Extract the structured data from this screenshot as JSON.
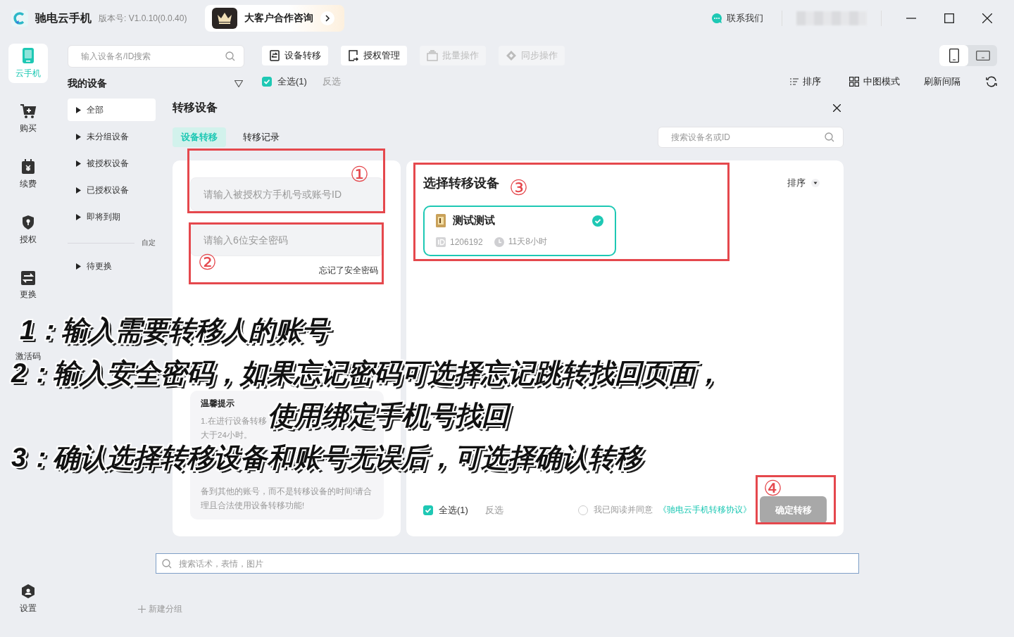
{
  "window": {
    "app_name": "驰电云手机",
    "version": "版本号: V1.0.10(0.0.40)",
    "promo": "大客户合作咨询",
    "contact": "联系我们"
  },
  "nav": [
    {
      "kind": "phone",
      "label": "云手机",
      "selected": true
    },
    {
      "kind": "cart",
      "label": "购买",
      "selected": false
    },
    {
      "kind": "renew",
      "label": "续费",
      "selected": false
    },
    {
      "kind": "shield",
      "label": "授权",
      "selected": false
    },
    {
      "kind": "swap",
      "label": "更换",
      "selected": false
    },
    {
      "kind": "code",
      "label": "激活码",
      "selected": false
    }
  ],
  "settings": "设置",
  "groups": {
    "search_placeholder": "输入设备名/ID搜索",
    "title": "我的设备",
    "items": [
      {
        "label": "全部",
        "selected": true
      },
      {
        "label": "未分组设备",
        "selected": false
      },
      {
        "label": "被授权设备",
        "selected": false
      },
      {
        "label": "已授权设备",
        "selected": false
      },
      {
        "label": "即将到期",
        "selected": false
      }
    ],
    "custom_label": "自定",
    "extra_items": [
      {
        "label": "待更换",
        "selected": false
      }
    ],
    "new_group": "新建分组"
  },
  "toolbar": {
    "buttons": [
      {
        "kind": "transfer",
        "label": "设备转移",
        "disabled": false
      },
      {
        "kind": "auth",
        "label": "授权管理",
        "disabled": false
      },
      {
        "kind": "batch",
        "label": "批量操作",
        "disabled": true
      },
      {
        "kind": "sync",
        "label": "同步操作",
        "disabled": true
      }
    ],
    "orientation": [
      {
        "kind": "portrait",
        "selected": true
      },
      {
        "kind": "landscape",
        "selected": false
      }
    ],
    "select_all": "全选(1)",
    "select_all_checked": true,
    "invert": "反选",
    "sort": "排序",
    "view_mode": "中图模式",
    "refresh": "刷新间隔"
  },
  "modal": {
    "title": "转移设备",
    "tabs": [
      {
        "label": "设备转移",
        "selected": true
      },
      {
        "label": "转移记录",
        "selected": false
      }
    ],
    "search_placeholder": "搜索设备名或ID",
    "account_placeholder": "请输入被授权方手机号或账号ID",
    "password_placeholder": "请输入6位安全密码",
    "forgot": "忘记了安全密码",
    "tips": {
      "title": "温馨提示",
      "lines_top": [
        "1.在进行设备转移",
        "大于24小时。"
      ],
      "lines_bottom": [
        "备到其他的账号，而不是转移设备的时间!请合",
        "理且合法使用设备转移功能!"
      ]
    },
    "device_section_title": "选择转移设备",
    "sort": "排序",
    "devices": [
      {
        "name": "测试测试",
        "id": "1206192",
        "remaining": "11天8小时",
        "selected": true
      }
    ],
    "select_all": "全选(1)",
    "select_all_checked": true,
    "invert": "反选",
    "agree_text": "我已阅读并同意",
    "agreement_link": "《驰电云手机转移协议》",
    "agreed": false,
    "confirm": "确定转移",
    "confirm_disabled": true
  },
  "bottom_search": {
    "placeholder": "搜索话术，表情，图片"
  },
  "annotations": {
    "steps": [
      "①",
      "②",
      "③",
      "④"
    ],
    "captions": [
      "1：输入需要转移人的账号",
      "2：输入安全密码，如果忘记密码可选择忘记跳转找回页面，",
      "使用绑定手机号找回",
      "3：确认选择转移设备和账号无误后，可选择确认转移"
    ]
  }
}
